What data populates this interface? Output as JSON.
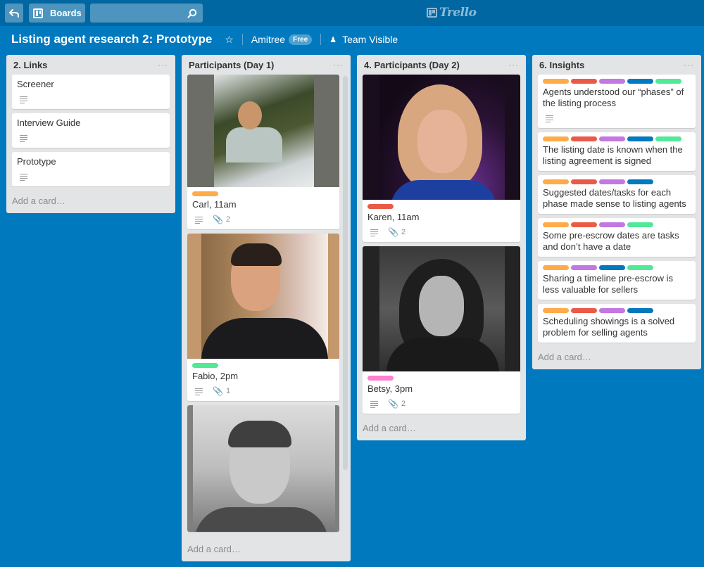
{
  "header": {
    "back_icon": "back-arrow-icon",
    "boards_label": "Boards",
    "search_value": "",
    "search_placeholder": "",
    "logo_text": "Trello"
  },
  "board": {
    "title": "Listing agent research 2: Prototype",
    "org": "Amitree",
    "org_badge": "Free",
    "visibility": "Team Visible"
  },
  "label_colors": {
    "orange": "#ffab4a",
    "red": "#eb5a46",
    "purple": "#c377e0",
    "blue": "#0079bf",
    "green": "#51e898",
    "pink": "#ff80ce"
  },
  "lists": [
    {
      "title": "2. Links",
      "menu": "···",
      "add_card": "Add a card…",
      "cards": [
        {
          "title": "Screener",
          "has_description": true
        },
        {
          "title": "Interview Guide",
          "has_description": true
        },
        {
          "title": "Prototype",
          "has_description": true
        }
      ]
    },
    {
      "title": "Participants (Day 1)",
      "menu": "···",
      "add_card": "Add a card…",
      "cards": [
        {
          "title": "Carl, 11am",
          "labels": [
            "orange"
          ],
          "has_description": true,
          "attachments": "2",
          "cover": "photo"
        },
        {
          "title": "Fabio, 2pm",
          "labels": [
            "green"
          ],
          "has_description": true,
          "attachments": "1",
          "cover": "photo"
        },
        {
          "title": "",
          "cover": "photo"
        }
      ]
    },
    {
      "title": "4. Participants (Day 2)",
      "menu": "···",
      "add_card": "Add a card…",
      "cards": [
        {
          "title": "Karen, 11am",
          "labels": [
            "red"
          ],
          "has_description": true,
          "attachments": "2",
          "cover": "photo"
        },
        {
          "title": "Betsy, 3pm",
          "labels": [
            "pink"
          ],
          "has_description": true,
          "attachments": "2",
          "cover": "photo"
        }
      ]
    },
    {
      "title": "6. Insights",
      "menu": "···",
      "add_card": "Add a card…",
      "cards": [
        {
          "title": "Agents understood our “phases” of the listing process",
          "labels": [
            "orange",
            "red",
            "purple",
            "blue",
            "green"
          ],
          "has_description": true
        },
        {
          "title": "The listing date is known when the listing agreement is signed",
          "labels": [
            "orange",
            "red",
            "purple",
            "blue",
            "green"
          ]
        },
        {
          "title": "Suggested dates/tasks for each phase made sense to listing agents",
          "labels": [
            "orange",
            "red",
            "purple",
            "blue"
          ]
        },
        {
          "title": "Some pre-escrow dates are tasks and don’t have a date",
          "labels": [
            "orange",
            "red",
            "purple",
            "green"
          ]
        },
        {
          "title": "Sharing a timeline pre-escrow is less valuable for sellers",
          "labels": [
            "orange",
            "purple",
            "blue",
            "green"
          ]
        },
        {
          "title": "Scheduling showings is a solved problem for selling agents",
          "labels": [
            "orange",
            "red",
            "purple",
            "blue"
          ]
        }
      ]
    }
  ]
}
